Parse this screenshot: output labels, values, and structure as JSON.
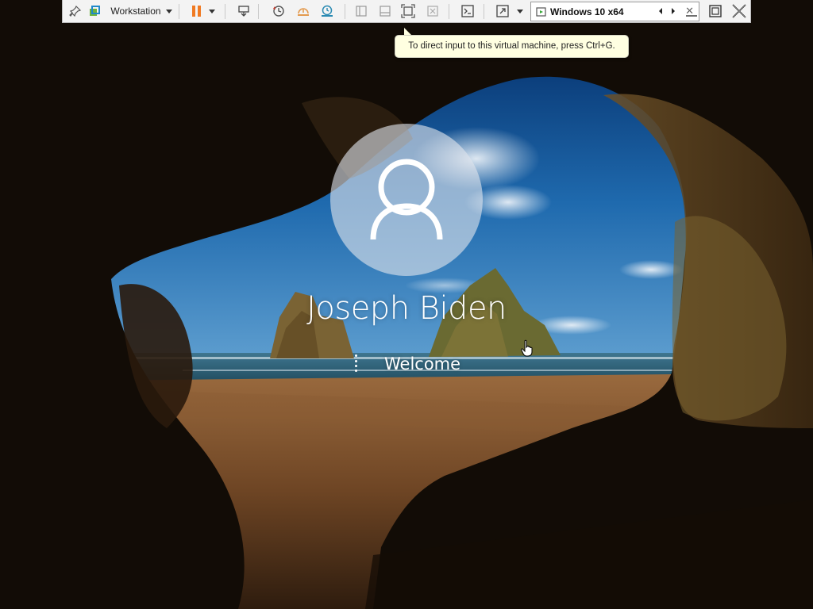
{
  "toolbar": {
    "product_menu_label": "Workstation",
    "vm_tab_label": "Windows 10 x64",
    "vm_tab_close": "✕",
    "icons": [
      "pin-icon",
      "vmware-logo-icon",
      "pause-icon",
      "send-ctrl-alt-del-icon",
      "snapshot-take-icon",
      "snapshot-revert-icon",
      "snapshot-manager-icon",
      "sidebar-toggle-icon",
      "thumbnail-bar-icon",
      "full-screen-icon",
      "unity-icon",
      "console-view-icon",
      "stretch-guest-icon",
      "vm-running-icon",
      "prev-tab-icon",
      "next-tab-icon",
      "minimize-icon",
      "restore-icon",
      "close-icon"
    ]
  },
  "tooltip": {
    "text": "To direct input to this virtual machine, press Ctrl+G."
  },
  "login": {
    "user_name": "Joseph Biden",
    "status": "Welcome"
  },
  "colors": {
    "toolbar_bg": "#f3f3f3",
    "tooltip_bg": "#ffffe1",
    "pause_orange": "#f07a22",
    "avatar_fill": "#dee4ec",
    "text_white": "#ffffff"
  }
}
